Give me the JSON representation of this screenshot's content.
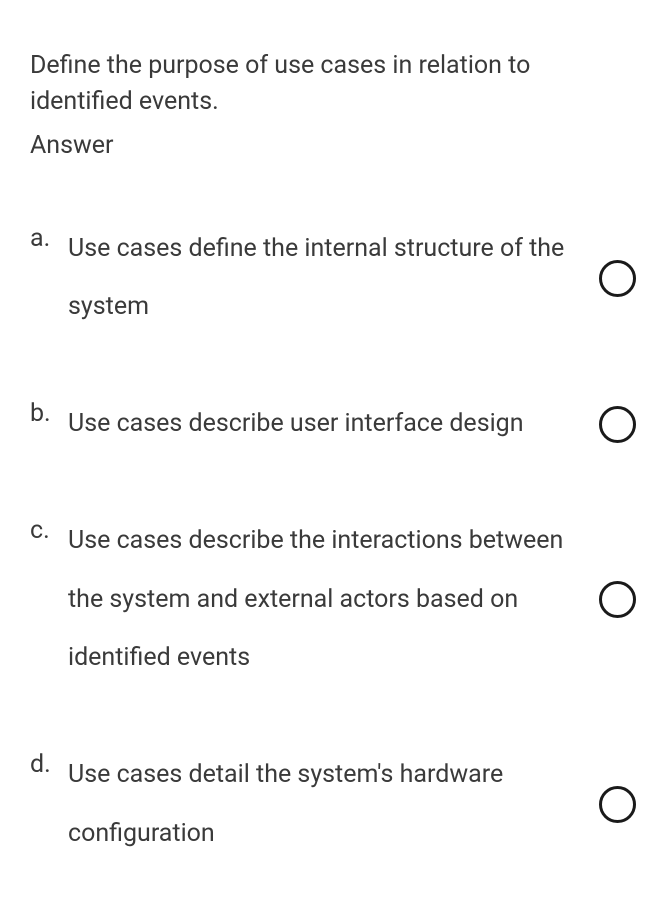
{
  "header": {
    "partial_text": ""
  },
  "question": {
    "text": "Define the purpose of use cases in relation to identified events.",
    "answer_label": "Answer"
  },
  "options": [
    {
      "letter": "a.",
      "text": "Use cases define the internal structure of the system"
    },
    {
      "letter": "b.",
      "text": "Use cases describe user interface design"
    },
    {
      "letter": "c.",
      "text": "Use cases describe the interactions between the system and external actors based on identified events"
    },
    {
      "letter": "d.",
      "text": "Use cases detail the system's hardware configuration"
    }
  ]
}
